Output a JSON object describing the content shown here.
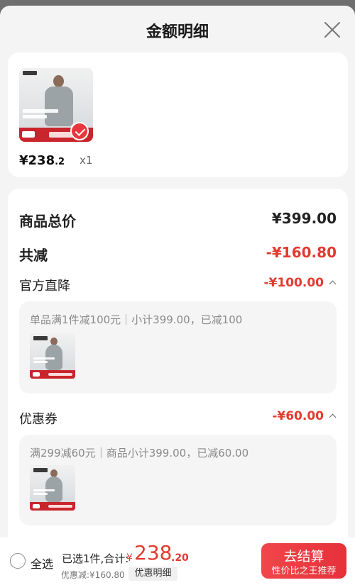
{
  "header": {
    "title": "金额明细"
  },
  "product": {
    "price_main": "¥238",
    "price_decimal": ".2",
    "quantity": "x1",
    "selected": true
  },
  "summary": {
    "total_label": "商品总价",
    "total_value": "¥399.00",
    "reduce_label": "共减",
    "reduce_value": "-¥160.80"
  },
  "discounts": [
    {
      "label": "官方直降",
      "value": "-¥100.00",
      "desc": "单品满1件减100元｜小计399.00，已减100"
    },
    {
      "label": "优惠券",
      "value": "-¥60.00",
      "desc": "满299减60元｜商品小计399.00，已减60.00"
    }
  ],
  "footer": {
    "select_all": "全选",
    "selected_text": "已选1件,合计:",
    "currency": "¥",
    "total_main": "238",
    "total_decimal": ".20",
    "discount_text": "优惠减:¥160.80",
    "detail_button": "优惠明细",
    "pay_button": "去结算",
    "pay_sub": "性价比之王推荐"
  },
  "colors": {
    "accent": "#e23b30",
    "button": "#e8383d"
  }
}
